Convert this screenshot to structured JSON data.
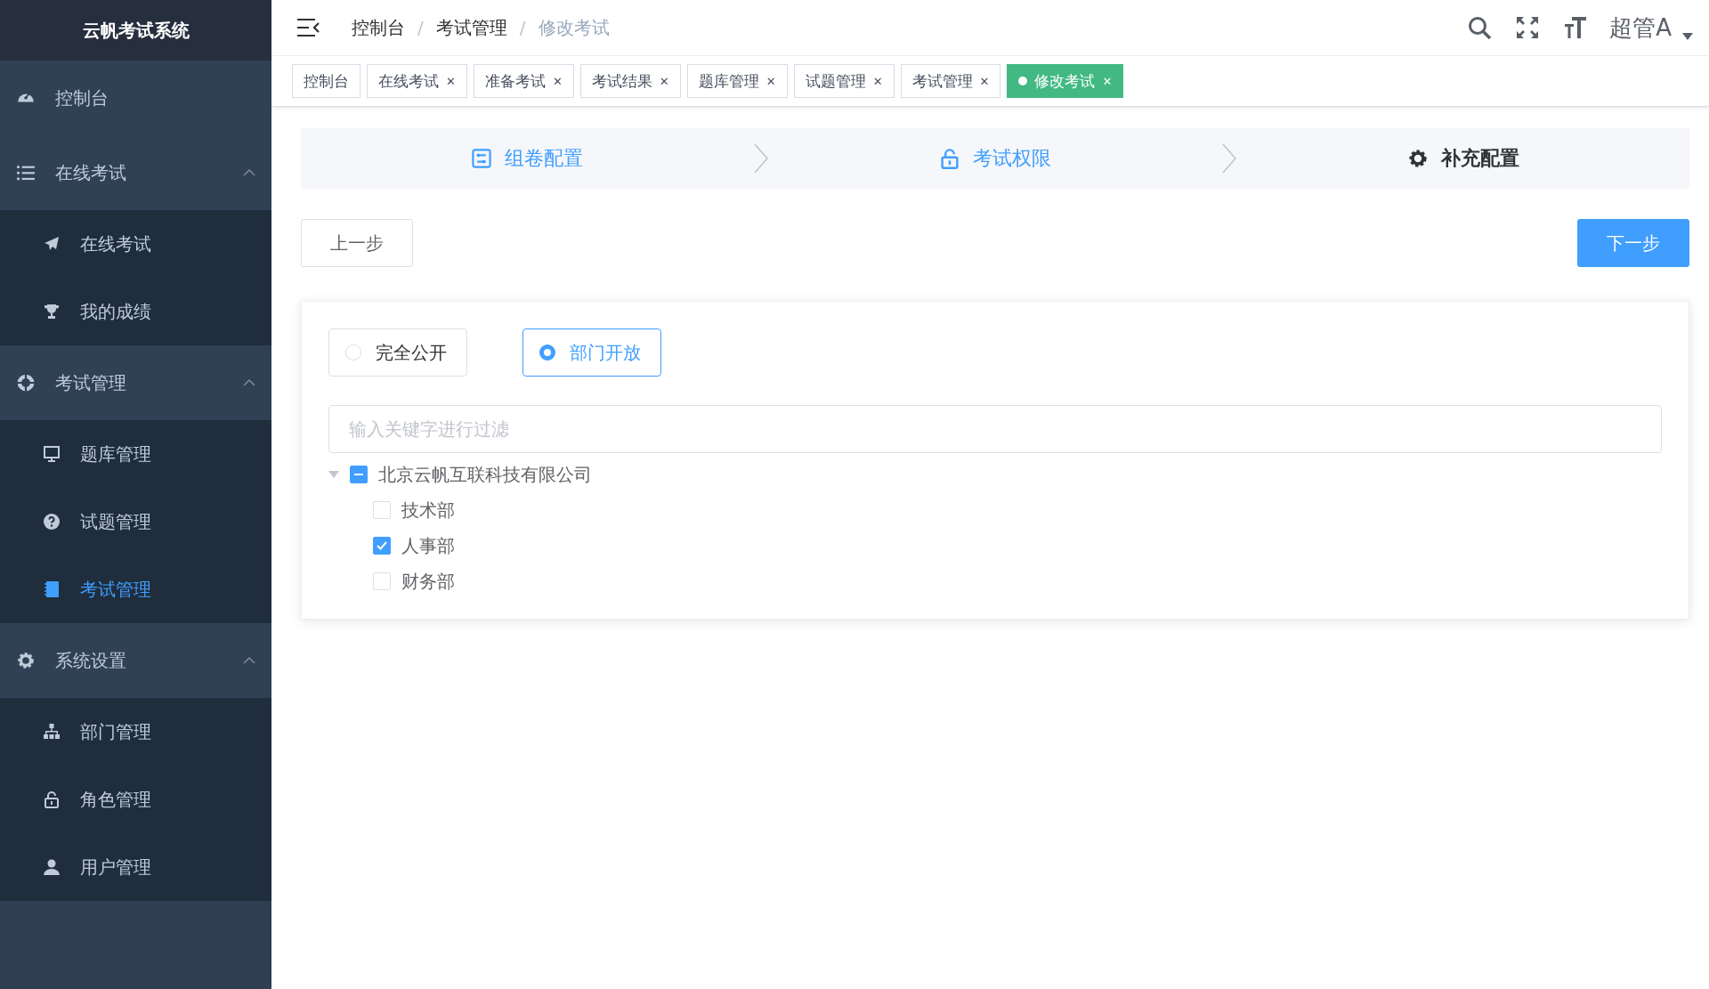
{
  "sidebar": {
    "title": "云帆考试系统",
    "items": [
      {
        "kind": "link",
        "label": "控制台",
        "selected": false
      },
      {
        "kind": "group",
        "label": "在线考试",
        "expanded": true,
        "children": [
          {
            "label": "在线考试",
            "selected": false
          },
          {
            "label": "我的成绩",
            "selected": false
          }
        ]
      },
      {
        "kind": "group",
        "label": "考试管理",
        "expanded": true,
        "children": [
          {
            "label": "题库管理",
            "selected": false
          },
          {
            "label": "试题管理",
            "selected": false
          },
          {
            "label": "考试管理",
            "selected": true
          }
        ]
      },
      {
        "kind": "group",
        "label": "系统设置",
        "expanded": true,
        "children": [
          {
            "label": "部门管理",
            "selected": false
          },
          {
            "label": "角色管理",
            "selected": false
          },
          {
            "label": "用户管理",
            "selected": false
          }
        ]
      }
    ]
  },
  "breadcrumb": [
    {
      "label": "控制台",
      "current": false
    },
    {
      "separator": "/",
      "label": "考试管理",
      "current": false
    },
    {
      "separator": "/",
      "label": "修改考试",
      "current": true
    }
  ],
  "user": {
    "name": "超管A"
  },
  "tabs": [
    {
      "label": "控制台",
      "selected": false
    },
    {
      "label": "在线考试",
      "close": "✕",
      "selected": false
    },
    {
      "label": "准备考试",
      "close": "✕",
      "selected": false
    },
    {
      "label": "考试结果",
      "close": "✕",
      "selected": false
    },
    {
      "label": "题库管理",
      "close": "✕",
      "selected": false
    },
    {
      "label": "试题管理",
      "close": "✕",
      "selected": false
    },
    {
      "label": "考试管理",
      "close": "✕",
      "selected": false
    },
    {
      "label": "修改考试",
      "close": "✕",
      "selected": true
    }
  ],
  "steps": [
    {
      "label": "组卷配置",
      "active": false
    },
    {
      "label": "考试权限",
      "active": false
    },
    {
      "label": "补充配置",
      "active": true
    }
  ],
  "buttons": {
    "prev": "上一步",
    "next": "下一步"
  },
  "access": {
    "options": [
      {
        "label": "完全公开",
        "selected": false
      },
      {
        "label": "部门开放",
        "selected": true
      }
    ],
    "filter": {
      "placeholder": "输入关键字进行过滤"
    },
    "tree": [
      {
        "label": "北京云帆互联科技有限公司",
        "indeterminate": true,
        "expanded": true,
        "children": [
          {
            "label": "技术部",
            "checked": false
          },
          {
            "label": "人事部",
            "checked": true
          },
          {
            "label": "财务部",
            "checked": false
          }
        ]
      }
    ]
  }
}
